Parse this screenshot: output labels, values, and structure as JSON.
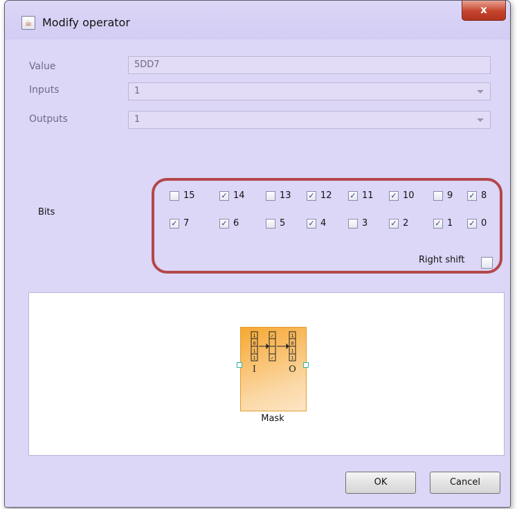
{
  "window": {
    "title": "Modify operator",
    "close_label": "x"
  },
  "form": {
    "value_label": "Value",
    "value": "5DD7",
    "inputs_label": "Inputs",
    "inputs_value": "1",
    "outputs_label": "Outputs",
    "outputs_value": "1"
  },
  "bits": {
    "label": "Bits",
    "items": [
      {
        "label": "15",
        "checked": false
      },
      {
        "label": "14",
        "checked": true
      },
      {
        "label": "13",
        "checked": false
      },
      {
        "label": "12",
        "checked": true
      },
      {
        "label": "11",
        "checked": true
      },
      {
        "label": "10",
        "checked": true
      },
      {
        "label": "9",
        "checked": false
      },
      {
        "label": "8",
        "checked": true
      },
      {
        "label": "7",
        "checked": true
      },
      {
        "label": "6",
        "checked": true
      },
      {
        "label": "5",
        "checked": false
      },
      {
        "label": "4",
        "checked": true
      },
      {
        "label": "3",
        "checked": false
      },
      {
        "label": "2",
        "checked": true
      },
      {
        "label": "1",
        "checked": true
      },
      {
        "label": "0",
        "checked": true
      }
    ],
    "right_shift_label": "Right shift",
    "right_shift_checked": false
  },
  "node": {
    "label": "Mask",
    "input_port": "I",
    "output_port": "O"
  },
  "buttons": {
    "ok": "OK",
    "cancel": "Cancel"
  },
  "colors": {
    "highlight": "#b3474a",
    "node_fill": "#f6a832",
    "window_bg": "#dcd6f7"
  }
}
